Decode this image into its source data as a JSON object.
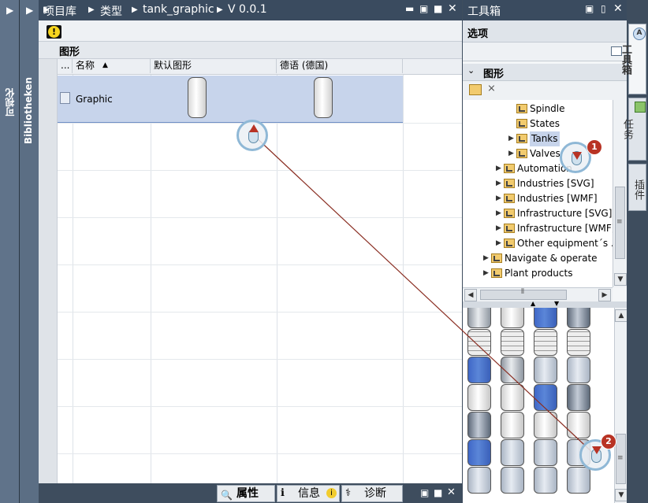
{
  "left_strip": {
    "label": "可视化"
  },
  "library_strip": {
    "label": "Bibliotheken"
  },
  "breadcrumb": {
    "items": [
      "项目库",
      "类型",
      "tank_graphic",
      "V 0.0.1"
    ]
  },
  "section": {
    "title": "图形"
  },
  "table": {
    "columns": [
      "...",
      "名称",
      "默认图形",
      "德语 (德国)"
    ],
    "rows": [
      {
        "name": "Graphic"
      }
    ]
  },
  "toolbox": {
    "title": "工具箱",
    "options_label": "选项",
    "graphics_label": "图形",
    "tree": [
      {
        "label": "Spindle",
        "indent": 3,
        "expandable": false
      },
      {
        "label": "States",
        "indent": 3,
        "expandable": false
      },
      {
        "label": "Tanks",
        "indent": 3,
        "expandable": true,
        "selected": true
      },
      {
        "label": "Valves",
        "indent": 3,
        "expandable": true
      },
      {
        "label": "Automation",
        "indent": 2,
        "expandable": true
      },
      {
        "label": "Industries [SVG]",
        "indent": 2,
        "expandable": true
      },
      {
        "label": "Industries [WMF]",
        "indent": 2,
        "expandable": true
      },
      {
        "label": "Infrastructure [SVG]",
        "indent": 2,
        "expandable": true
      },
      {
        "label": "Infrastructure [WMF]",
        "indent": 2,
        "expandable": true
      },
      {
        "label": "Other equipment´s ...",
        "indent": 2,
        "expandable": true
      },
      {
        "label": "Navigate & operate",
        "indent": 1,
        "expandable": true
      },
      {
        "label": "Plant products",
        "indent": 1,
        "expandable": true
      }
    ]
  },
  "side_tabs": [
    "工具箱",
    "任务",
    "插件"
  ],
  "bottom_tabs": [
    {
      "label": "属性"
    },
    {
      "label": "信息"
    },
    {
      "label": "诊断"
    }
  ],
  "step_badges": [
    "1",
    "2"
  ],
  "colors": {
    "accent": "#3a4b5f",
    "selection": "#c7d4eb",
    "tank_blue": "#5b86d8",
    "badge": "#b83324"
  }
}
